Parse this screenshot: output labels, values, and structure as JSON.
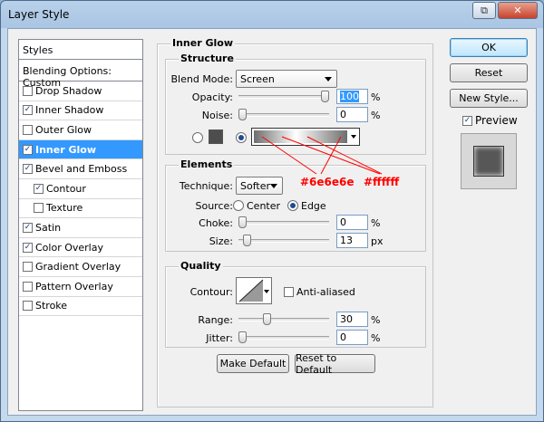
{
  "window": {
    "title": "Layer Style"
  },
  "styles": {
    "header": "Styles",
    "blending": "Blending Options: Custom",
    "items": [
      {
        "label": "Drop Shadow",
        "checked": false,
        "sub": false,
        "selected": false
      },
      {
        "label": "Inner Shadow",
        "checked": true,
        "sub": false,
        "selected": false
      },
      {
        "label": "Outer Glow",
        "checked": false,
        "sub": false,
        "selected": false
      },
      {
        "label": "Inner Glow",
        "checked": true,
        "sub": false,
        "selected": true
      },
      {
        "label": "Bevel and Emboss",
        "checked": true,
        "sub": false,
        "selected": false
      },
      {
        "label": "Contour",
        "checked": true,
        "sub": true,
        "selected": false
      },
      {
        "label": "Texture",
        "checked": false,
        "sub": true,
        "selected": false
      },
      {
        "label": "Satin",
        "checked": true,
        "sub": false,
        "selected": false
      },
      {
        "label": "Color Overlay",
        "checked": true,
        "sub": false,
        "selected": false
      },
      {
        "label": "Gradient Overlay",
        "checked": false,
        "sub": false,
        "selected": false
      },
      {
        "label": "Pattern Overlay",
        "checked": false,
        "sub": false,
        "selected": false
      },
      {
        "label": "Stroke",
        "checked": false,
        "sub": false,
        "selected": false
      }
    ]
  },
  "inner_glow": {
    "title": "Inner Glow",
    "structure": {
      "title": "Structure",
      "blend_mode_label": "Blend Mode:",
      "blend_mode_value": "Screen",
      "opacity_label": "Opacity:",
      "opacity_value": "100",
      "opacity_level": 100,
      "noise_label": "Noise:",
      "noise_value": "0",
      "noise_level": 0,
      "percent": "%",
      "swatch_color": "#4d4d4d"
    },
    "elements": {
      "title": "Elements",
      "technique_label": "Technique:",
      "technique_value": "Softer",
      "source_label": "Source:",
      "source_center": "Center",
      "source_edge": "Edge",
      "choke_label": "Choke:",
      "choke_value": "0",
      "choke_level": 0,
      "size_label": "Size:",
      "size_value": "13",
      "size_level": 5,
      "percent": "%",
      "px": "px"
    },
    "quality": {
      "title": "Quality",
      "contour_label": "Contour:",
      "anti_aliased": "Anti-aliased",
      "range_label": "Range:",
      "range_value": "30",
      "range_level": 30,
      "jitter_label": "Jitter:",
      "jitter_value": "0",
      "jitter_level": 0,
      "percent": "%"
    },
    "buttons": {
      "make_default": "Make Default",
      "reset_default": "Reset to Default"
    }
  },
  "annotations": {
    "color1": "#6e6e6e",
    "color2": "#ffffff",
    "color": "#ff0000"
  },
  "actions": {
    "ok": "OK",
    "reset": "Reset",
    "new_style": "New Style...",
    "preview": "Preview"
  },
  "colors": {
    "selection": "#3399ff",
    "preview_swatch": "#575757"
  }
}
